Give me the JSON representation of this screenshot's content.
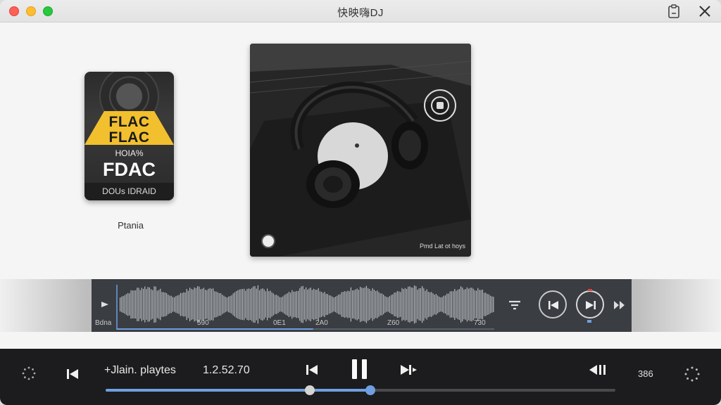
{
  "window": {
    "title": "快映嗨DJ"
  },
  "format_card": {
    "line1": "FLAC",
    "line2": "FLAC",
    "line3": "HOIA%",
    "line4": "FDAC",
    "footer": "DOUs IDRAID",
    "label": "Ptania"
  },
  "album": {
    "caption": "Pmd Lat ot hoys"
  },
  "waveform": {
    "start_label": "Bdna",
    "tick_labels": [
      "590",
      "0E1",
      "2A0",
      "Z60",
      "730"
    ],
    "played": 0.52
  },
  "player": {
    "now_playing": "+Jlain. playtes",
    "time": "1.2.52.70",
    "volume": "386",
    "progress": 0.4,
    "buffered": 0.52
  },
  "colors": {
    "accent": "#6f9fe0",
    "record_red": "#e0443e",
    "flac_yellow": "#f2c02e"
  }
}
